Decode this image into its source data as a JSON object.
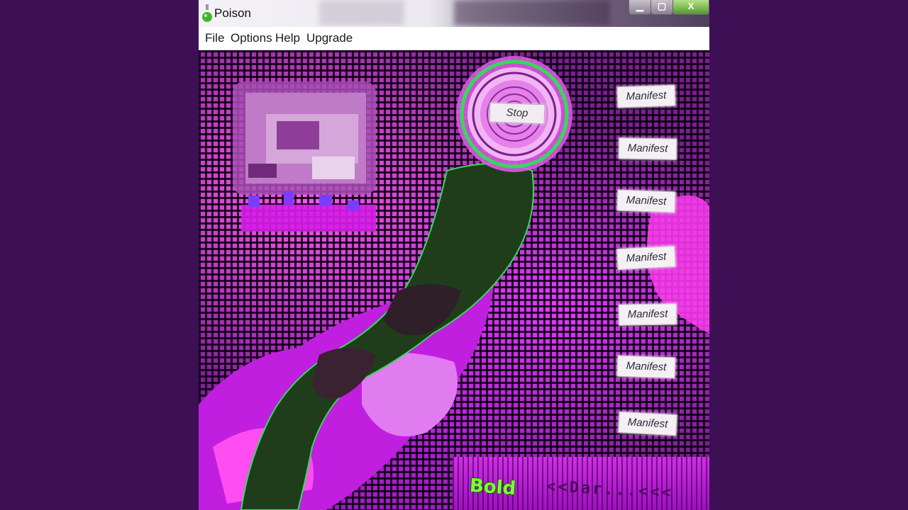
{
  "window": {
    "title": "Poison",
    "controls": {
      "minimize": "▁",
      "maximize": "▢",
      "close": "X"
    }
  },
  "menu": {
    "items": [
      "File",
      "Options",
      "Help",
      "Upgrade"
    ]
  },
  "buttons": {
    "stop": "Stop",
    "manifest": [
      "Manifest",
      "Manifest",
      "Manifest",
      "Manifest",
      "Manifest",
      "Manifest",
      "Manifest"
    ]
  },
  "footer": {
    "bold_label": "Bold",
    "faded_label": "<<Dar...<<<"
  },
  "colors": {
    "background": "#3d0f55",
    "grid_magenta": "#e43bff",
    "neon_green": "#7dff3a",
    "ring_green": "#36d95a"
  },
  "icons": {
    "app_icon": "potion-bottle-icon",
    "stop_ring": "concentric-ring-icon"
  }
}
